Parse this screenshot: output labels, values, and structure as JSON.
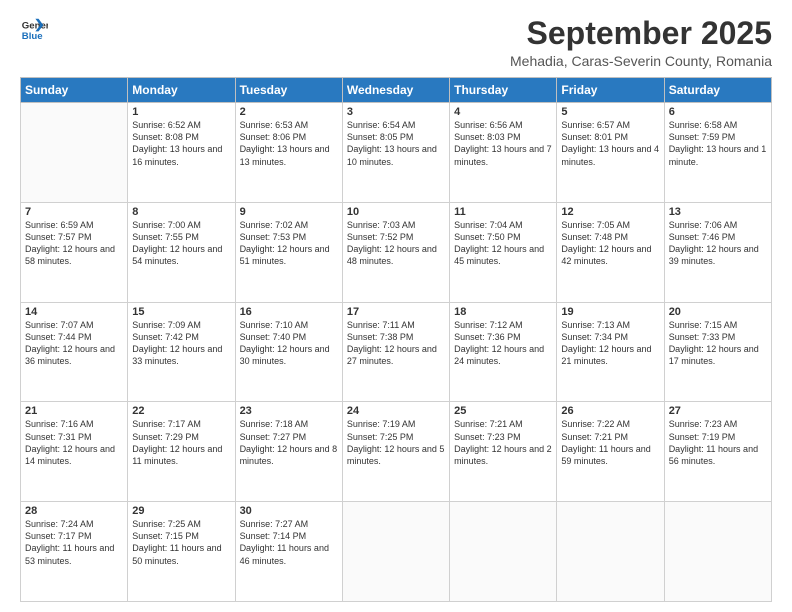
{
  "logo": {
    "line1": "General",
    "line2": "Blue"
  },
  "title": "September 2025",
  "subtitle": "Mehadia, Caras-Severin County, Romania",
  "days_header": [
    "Sunday",
    "Monday",
    "Tuesday",
    "Wednesday",
    "Thursday",
    "Friday",
    "Saturday"
  ],
  "weeks": [
    [
      {
        "day": "",
        "info": ""
      },
      {
        "day": "1",
        "info": "Sunrise: 6:52 AM\nSunset: 8:08 PM\nDaylight: 13 hours\nand 16 minutes."
      },
      {
        "day": "2",
        "info": "Sunrise: 6:53 AM\nSunset: 8:06 PM\nDaylight: 13 hours\nand 13 minutes."
      },
      {
        "day": "3",
        "info": "Sunrise: 6:54 AM\nSunset: 8:05 PM\nDaylight: 13 hours\nand 10 minutes."
      },
      {
        "day": "4",
        "info": "Sunrise: 6:56 AM\nSunset: 8:03 PM\nDaylight: 13 hours\nand 7 minutes."
      },
      {
        "day": "5",
        "info": "Sunrise: 6:57 AM\nSunset: 8:01 PM\nDaylight: 13 hours\nand 4 minutes."
      },
      {
        "day": "6",
        "info": "Sunrise: 6:58 AM\nSunset: 7:59 PM\nDaylight: 13 hours\nand 1 minute."
      }
    ],
    [
      {
        "day": "7",
        "info": "Sunrise: 6:59 AM\nSunset: 7:57 PM\nDaylight: 12 hours\nand 58 minutes."
      },
      {
        "day": "8",
        "info": "Sunrise: 7:00 AM\nSunset: 7:55 PM\nDaylight: 12 hours\nand 54 minutes."
      },
      {
        "day": "9",
        "info": "Sunrise: 7:02 AM\nSunset: 7:53 PM\nDaylight: 12 hours\nand 51 minutes."
      },
      {
        "day": "10",
        "info": "Sunrise: 7:03 AM\nSunset: 7:52 PM\nDaylight: 12 hours\nand 48 minutes."
      },
      {
        "day": "11",
        "info": "Sunrise: 7:04 AM\nSunset: 7:50 PM\nDaylight: 12 hours\nand 45 minutes."
      },
      {
        "day": "12",
        "info": "Sunrise: 7:05 AM\nSunset: 7:48 PM\nDaylight: 12 hours\nand 42 minutes."
      },
      {
        "day": "13",
        "info": "Sunrise: 7:06 AM\nSunset: 7:46 PM\nDaylight: 12 hours\nand 39 minutes."
      }
    ],
    [
      {
        "day": "14",
        "info": "Sunrise: 7:07 AM\nSunset: 7:44 PM\nDaylight: 12 hours\nand 36 minutes."
      },
      {
        "day": "15",
        "info": "Sunrise: 7:09 AM\nSunset: 7:42 PM\nDaylight: 12 hours\nand 33 minutes."
      },
      {
        "day": "16",
        "info": "Sunrise: 7:10 AM\nSunset: 7:40 PM\nDaylight: 12 hours\nand 30 minutes."
      },
      {
        "day": "17",
        "info": "Sunrise: 7:11 AM\nSunset: 7:38 PM\nDaylight: 12 hours\nand 27 minutes."
      },
      {
        "day": "18",
        "info": "Sunrise: 7:12 AM\nSunset: 7:36 PM\nDaylight: 12 hours\nand 24 minutes."
      },
      {
        "day": "19",
        "info": "Sunrise: 7:13 AM\nSunset: 7:34 PM\nDaylight: 12 hours\nand 21 minutes."
      },
      {
        "day": "20",
        "info": "Sunrise: 7:15 AM\nSunset: 7:33 PM\nDaylight: 12 hours\nand 17 minutes."
      }
    ],
    [
      {
        "day": "21",
        "info": "Sunrise: 7:16 AM\nSunset: 7:31 PM\nDaylight: 12 hours\nand 14 minutes."
      },
      {
        "day": "22",
        "info": "Sunrise: 7:17 AM\nSunset: 7:29 PM\nDaylight: 12 hours\nand 11 minutes."
      },
      {
        "day": "23",
        "info": "Sunrise: 7:18 AM\nSunset: 7:27 PM\nDaylight: 12 hours\nand 8 minutes."
      },
      {
        "day": "24",
        "info": "Sunrise: 7:19 AM\nSunset: 7:25 PM\nDaylight: 12 hours\nand 5 minutes."
      },
      {
        "day": "25",
        "info": "Sunrise: 7:21 AM\nSunset: 7:23 PM\nDaylight: 12 hours\nand 2 minutes."
      },
      {
        "day": "26",
        "info": "Sunrise: 7:22 AM\nSunset: 7:21 PM\nDaylight: 11 hours\nand 59 minutes."
      },
      {
        "day": "27",
        "info": "Sunrise: 7:23 AM\nSunset: 7:19 PM\nDaylight: 11 hours\nand 56 minutes."
      }
    ],
    [
      {
        "day": "28",
        "info": "Sunrise: 7:24 AM\nSunset: 7:17 PM\nDaylight: 11 hours\nand 53 minutes."
      },
      {
        "day": "29",
        "info": "Sunrise: 7:25 AM\nSunset: 7:15 PM\nDaylight: 11 hours\nand 50 minutes."
      },
      {
        "day": "30",
        "info": "Sunrise: 7:27 AM\nSunset: 7:14 PM\nDaylight: 11 hours\nand 46 minutes."
      },
      {
        "day": "",
        "info": ""
      },
      {
        "day": "",
        "info": ""
      },
      {
        "day": "",
        "info": ""
      },
      {
        "day": "",
        "info": ""
      }
    ]
  ]
}
